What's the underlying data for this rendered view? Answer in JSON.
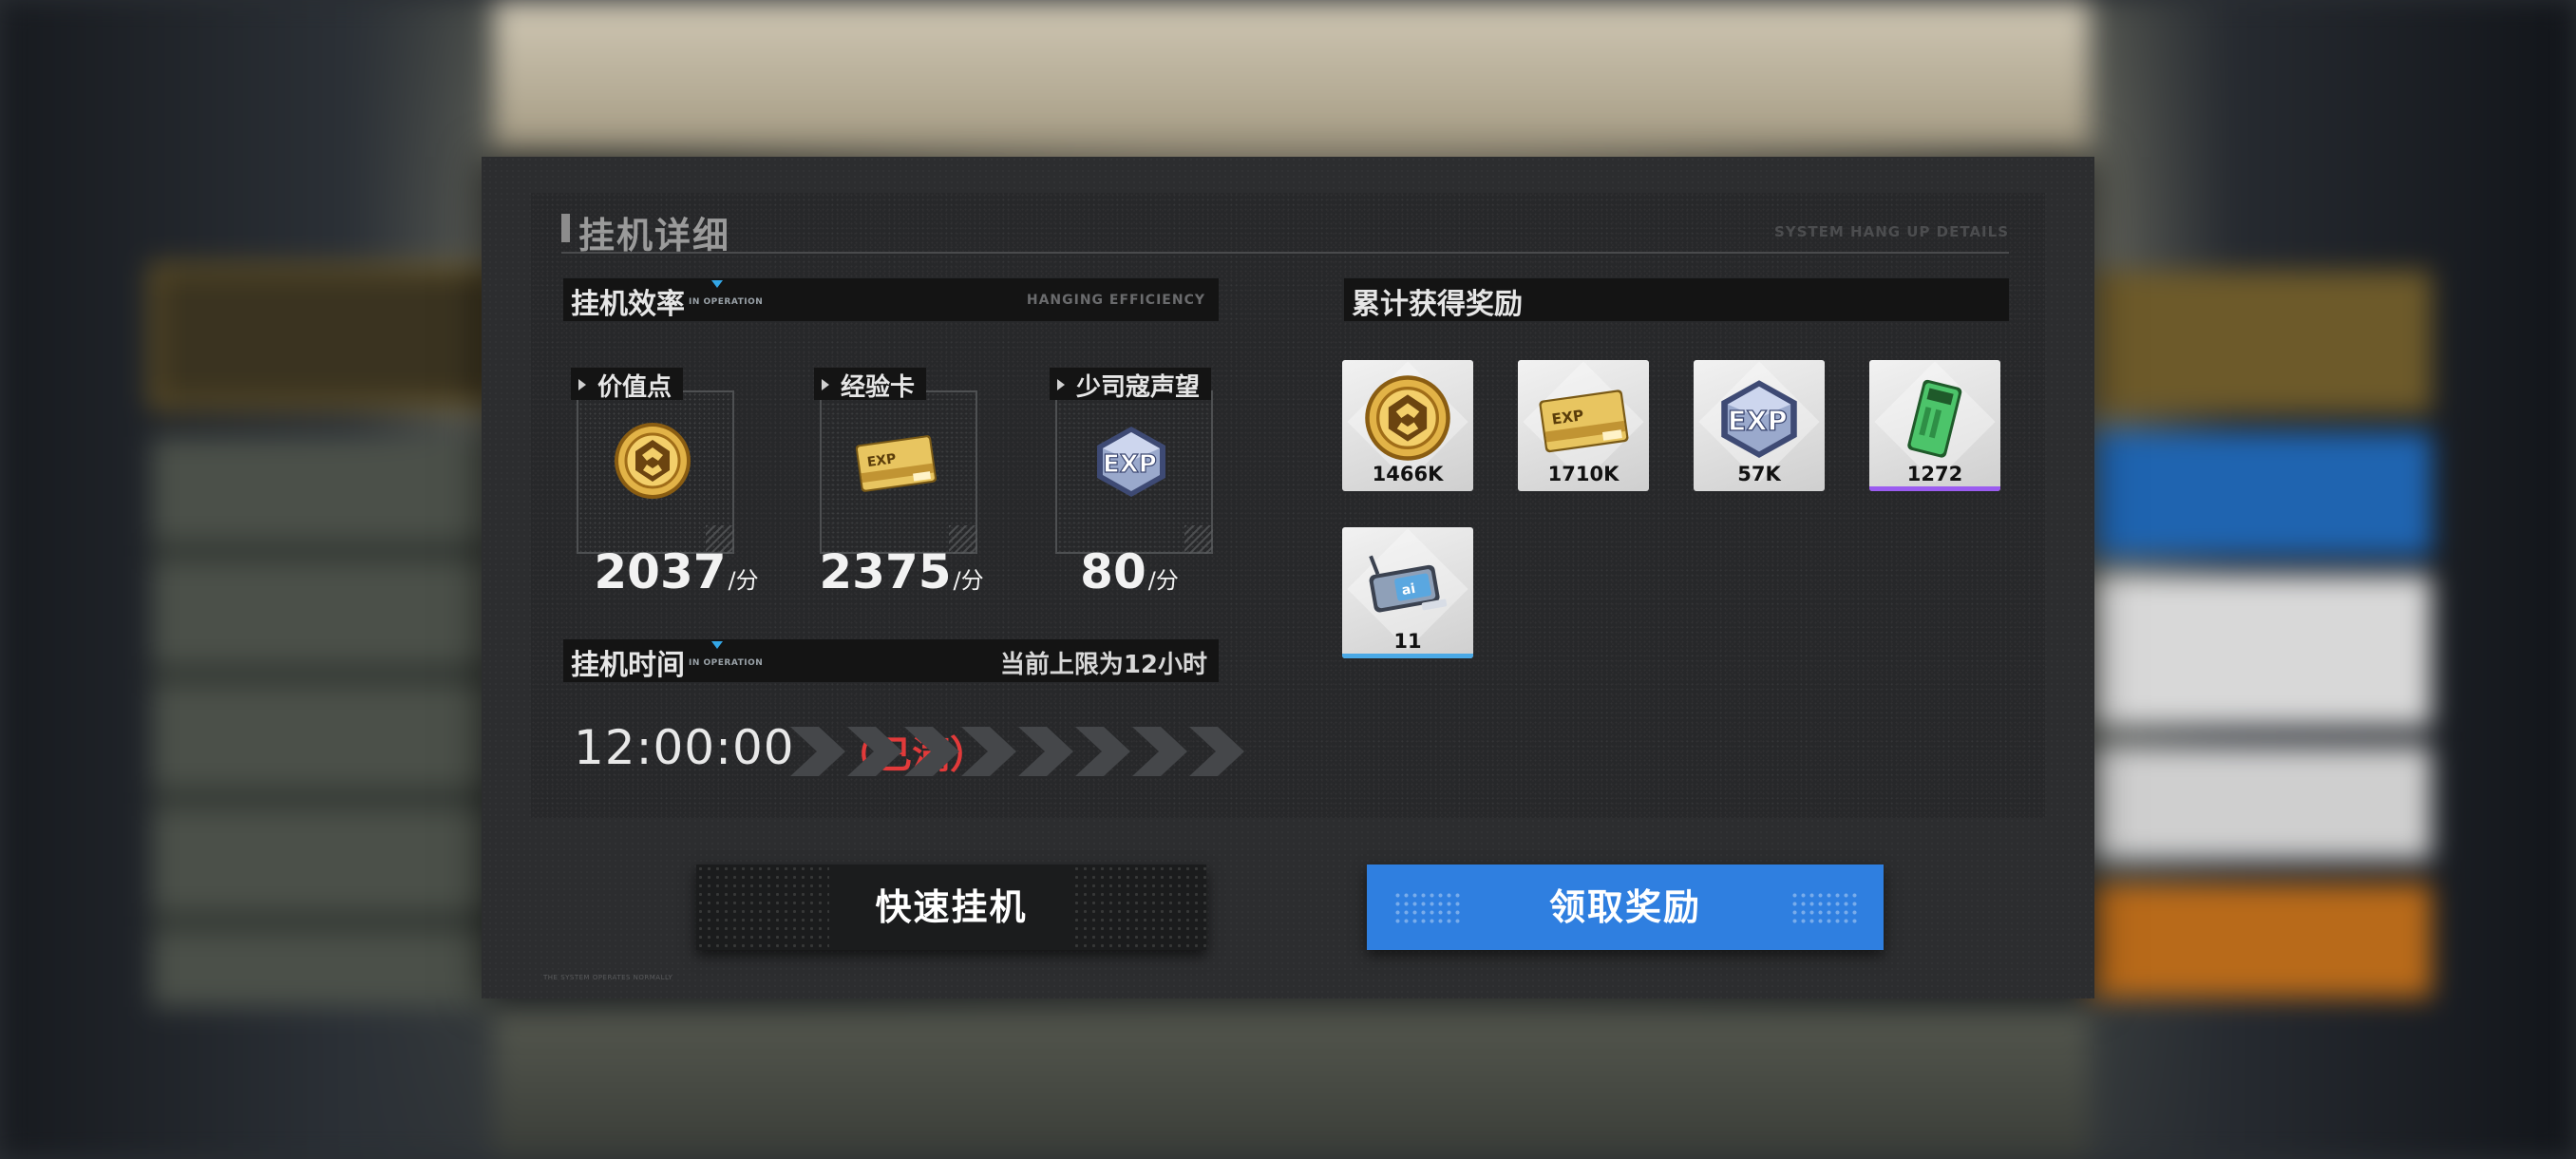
{
  "panel": {
    "title": "挂机详细",
    "title_en": "SYSTEM HANG UP DETAILS",
    "footer_en": "THE SYSTEM OPERATES NORMALLY"
  },
  "efficiency": {
    "label": "挂机效率",
    "status_en": "IN OPERATION",
    "label_en": "HANGING EFFICIENCY",
    "cards": [
      {
        "name": "价值点",
        "icon": "gold-coin-icon",
        "rate": "2037",
        "unit": "/分"
      },
      {
        "name": "经验卡",
        "icon": "exp-card-icon",
        "rate": "2375",
        "unit": "/分"
      },
      {
        "name": "少司寇声望",
        "icon": "exp-crystal-icon",
        "rate": "80",
        "unit": "/分"
      }
    ]
  },
  "hang_time": {
    "label": "挂机时间",
    "status_en": "IN OPERATION",
    "limit_text": "当前上限为12小时",
    "time": "12:00:00",
    "full_text": "（已满）"
  },
  "rewards": {
    "label": "累计获得奖励",
    "items": [
      {
        "icon": "gold-coin-icon",
        "qty": "1466K",
        "rarity_color": ""
      },
      {
        "icon": "exp-card-icon",
        "qty": "1710K",
        "rarity_color": ""
      },
      {
        "icon": "exp-crystal-icon",
        "qty": "57K",
        "rarity_color": ""
      },
      {
        "icon": "green-chip-card-icon",
        "qty": "1272",
        "rarity_color": "#9b5cf0"
      },
      {
        "icon": "ai-device-icon",
        "qty": "11",
        "rarity_color": "#4aa9e6"
      }
    ]
  },
  "buttons": {
    "quick_hang": "快速挂机",
    "claim": "领取奖励"
  },
  "colors": {
    "accent_blue": "#2f7fe0",
    "full_red": "#e23a3a",
    "panel_bg": "#2c2d2f"
  }
}
